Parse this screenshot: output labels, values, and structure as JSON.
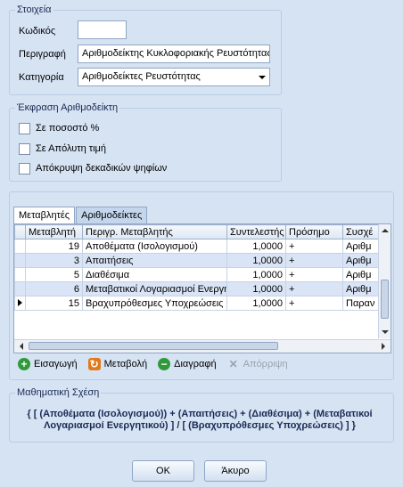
{
  "details": {
    "title": "Στοιχεία",
    "code_label": "Κωδικός",
    "code_value": "",
    "description_label": "Περιγραφή",
    "description_value": "Αριθμοδείκτης Κυκλοφοριακής Ρευστότητας",
    "category_label": "Κατηγορία",
    "category_value": "Αριθμοδείκτες Ρευστότητας"
  },
  "expression": {
    "title": "Έκφραση Αριθμοδείκτη",
    "options": [
      {
        "label": "Σε ποσοστό %",
        "checked": false
      },
      {
        "label": "Σε Απόλυτη τιμή",
        "checked": false
      },
      {
        "label": "Απόκρυψη δεκαδικών ψηφίων",
        "checked": false
      }
    ]
  },
  "tabs": [
    {
      "label": "Μεταβλητές",
      "active": true
    },
    {
      "label": "Αριθμοδείκτες",
      "active": false
    }
  ],
  "grid": {
    "columns": [
      "Μεταβλητή",
      "Περιγρ. Μεταβλητής",
      "Συντελεστής",
      "Πρόσημο",
      "Συσχέ"
    ],
    "rows": [
      {
        "cells": [
          "19",
          "Αποθέματα (Ισολογισμού)",
          "1,0000",
          "+",
          "Αριθμ"
        ],
        "current": false
      },
      {
        "cells": [
          "3",
          "Απαιτήσεις",
          "1,0000",
          "+",
          "Αριθμ"
        ],
        "current": false
      },
      {
        "cells": [
          "5",
          "Διαθέσιμα",
          "1,0000",
          "+",
          "Αριθμ"
        ],
        "current": false
      },
      {
        "cells": [
          "6",
          "Μεταβατικοί Λογαριασμοί Ενεργητ",
          "1,0000",
          "+",
          "Αριθμ"
        ],
        "current": false
      },
      {
        "cells": [
          "15",
          "Βραχυπρόθεσμες Υποχρεώσεις",
          "1,0000",
          "+",
          "Παραν"
        ],
        "current": true
      }
    ]
  },
  "toolbar": {
    "insert": "Εισαγωγή",
    "modify": "Μεταβολή",
    "delete": "Διαγραφή",
    "reject": "Απόρριψη"
  },
  "formula": {
    "title": "Μαθηματική Σχέση",
    "text": "{ [ (Αποθέματα (Ισολογισμού)) + (Απαιτήσεις) + (Διαθέσιμα) + (Μεταβατικοί Λογαριασμοί Ενεργητικού) ] / [ (Βραχυπρόθεσμες Υποχρεώσεις) ] }"
  },
  "buttons": {
    "ok": "OK",
    "cancel": "Άκυρο"
  }
}
